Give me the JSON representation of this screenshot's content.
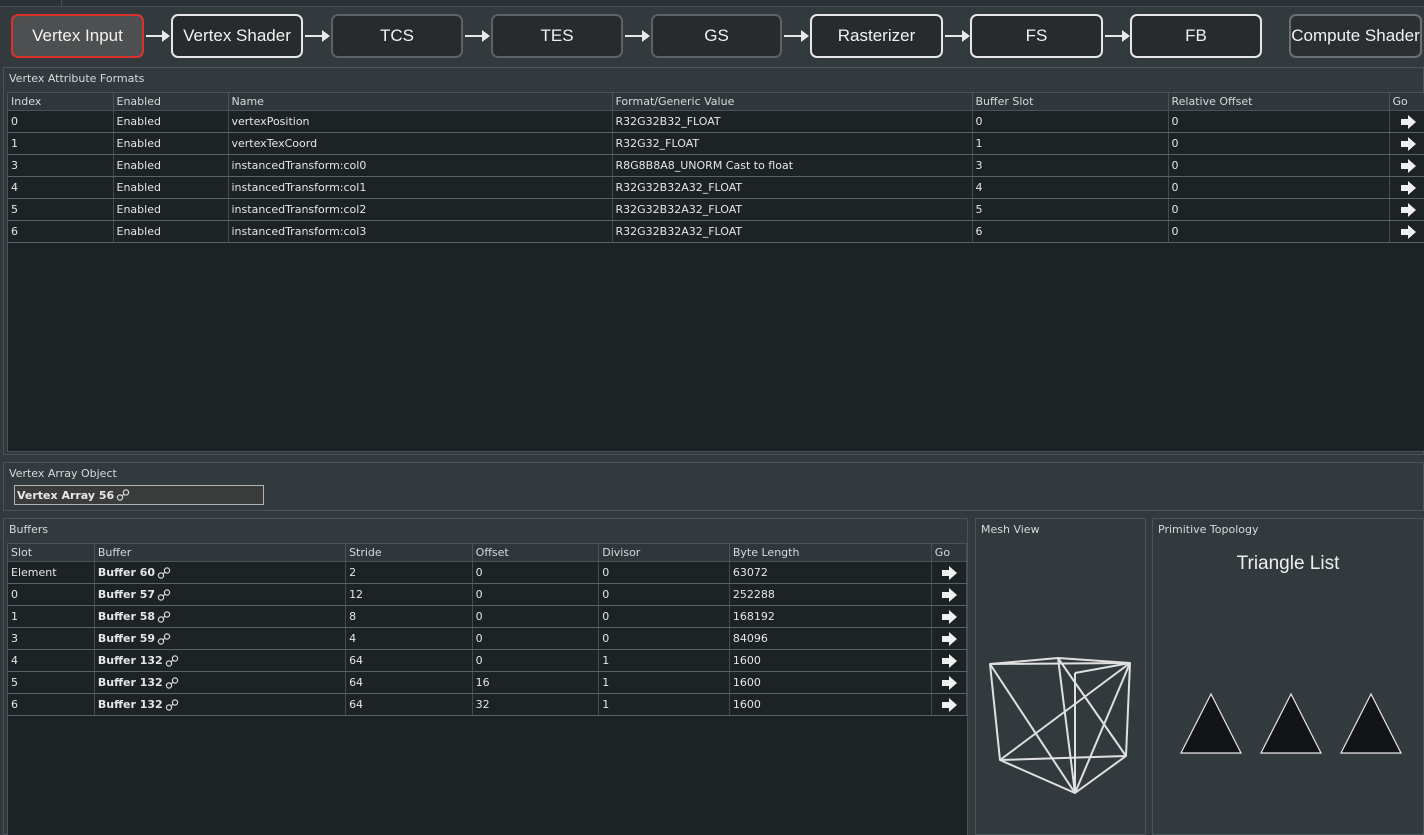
{
  "pipeline": {
    "stages": [
      {
        "label": "Vertex Input"
      },
      {
        "label": "Vertex Shader"
      },
      {
        "label": "TCS"
      },
      {
        "label": "TES"
      },
      {
        "label": "GS"
      },
      {
        "label": "Rasterizer"
      },
      {
        "label": "FS"
      },
      {
        "label": "FB"
      },
      {
        "label": "Compute Shader"
      }
    ],
    "selected": "Vertex Input",
    "colors": {
      "selected_border": "#d8322a",
      "used_border": "#e6e6e6",
      "unused_border": "#5c6265"
    }
  },
  "vertex_attributes": {
    "title": "Vertex Attribute Formats",
    "columns": [
      "Index",
      "Enabled",
      "Name",
      "Format/Generic Value",
      "Buffer Slot",
      "Relative Offset",
      "Go"
    ],
    "rows": [
      [
        "0",
        "Enabled",
        "vertexPosition",
        "R32G32B32_FLOAT",
        "0",
        "0"
      ],
      [
        "1",
        "Enabled",
        "vertexTexCoord",
        "R32G32_FLOAT",
        "1",
        "0"
      ],
      [
        "3",
        "Enabled",
        "instancedTransform:col0",
        "R8G8B8A8_UNORM Cast to float",
        "3",
        "0"
      ],
      [
        "4",
        "Enabled",
        "instancedTransform:col1",
        "R32G32B32A32_FLOAT",
        "4",
        "0"
      ],
      [
        "5",
        "Enabled",
        "instancedTransform:col2",
        "R32G32B32A32_FLOAT",
        "5",
        "0"
      ],
      [
        "6",
        "Enabled",
        "instancedTransform:col3",
        "R32G32B32A32_FLOAT",
        "6",
        "0"
      ]
    ]
  },
  "vao": {
    "title": "Vertex Array Object",
    "value": "Vertex Array 56"
  },
  "buffers": {
    "title": "Buffers",
    "columns": [
      "Slot",
      "Buffer",
      "Stride",
      "Offset",
      "Divisor",
      "Byte Length",
      "Go"
    ],
    "rows": [
      [
        "Element",
        "Buffer 60",
        "2",
        "0",
        "0",
        "63072"
      ],
      [
        "0",
        "Buffer 57",
        "12",
        "0",
        "0",
        "252288"
      ],
      [
        "1",
        "Buffer 58",
        "8",
        "0",
        "0",
        "168192"
      ],
      [
        "3",
        "Buffer 59",
        "4",
        "0",
        "0",
        "84096"
      ],
      [
        "4",
        "Buffer 132",
        "64",
        "0",
        "1",
        "1600"
      ],
      [
        "5",
        "Buffer 132",
        "64",
        "16",
        "1",
        "1600"
      ],
      [
        "6",
        "Buffer 132",
        "64",
        "32",
        "1",
        "1600"
      ]
    ]
  },
  "mesh_view": {
    "title": "Mesh View"
  },
  "topology": {
    "title": "Primitive Topology",
    "value": "Triangle List"
  },
  "icons": {
    "go": "arrow-right-icon",
    "link": "link-icon"
  }
}
